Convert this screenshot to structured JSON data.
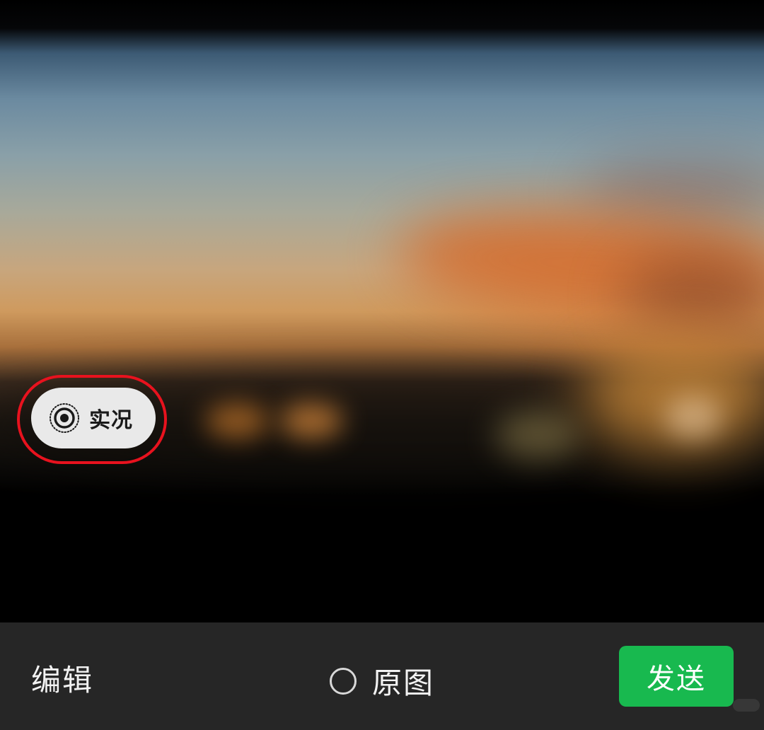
{
  "photo": {
    "alt_description": "",
    "icons": {
      "live": "live-photo-icon"
    }
  },
  "live_badge": {
    "label": "实况"
  },
  "toolbar": {
    "edit_label": "编辑",
    "original_label": "原图",
    "original_checked": false,
    "send_label": "发送"
  },
  "colors": {
    "send_button": "#18b94f",
    "toolbar_bg": "#262626",
    "highlight_ring": "#e8121e",
    "badge_bg": "#e9e9e9"
  }
}
